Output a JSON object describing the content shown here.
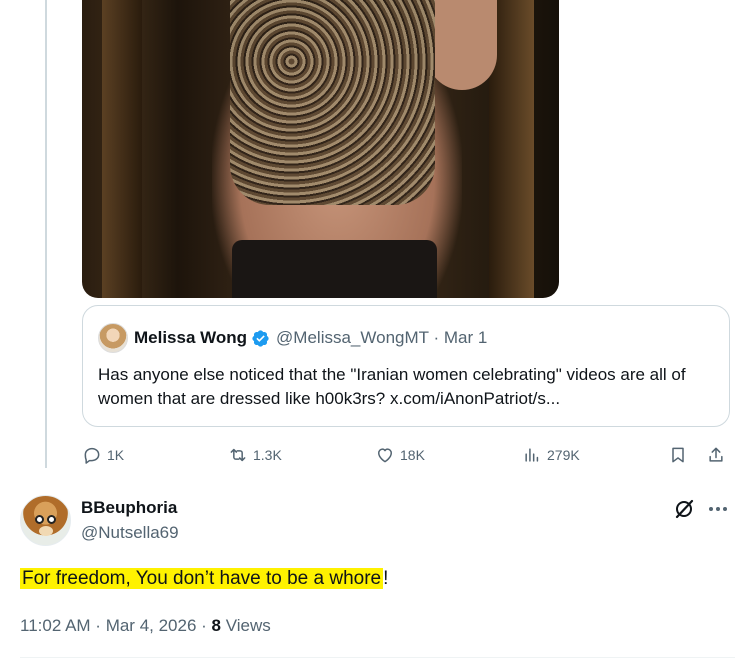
{
  "quoted_tweet": {
    "name": "Melissa Wong",
    "handle": "@Melissa_WongMT",
    "separator": "·",
    "date": "Mar 1",
    "text": "Has anyone else noticed that the \"Iranian women celebrating\" videos are all of women that are dressed like h00k3rs? x.com/iAnonPatriot/s..."
  },
  "actions": {
    "replies": "1K",
    "reposts": "1.3K",
    "likes": "18K",
    "views": "279K"
  },
  "reply": {
    "name": "BBeuphoria",
    "handle": "@Nutsella69",
    "text_highlighted": "For freedom, You don’t have to be a whore",
    "text_suffix": "!",
    "time": "11:02 AM",
    "date": "Mar 4, 2026",
    "views_count": "8",
    "views_label": "Views"
  },
  "colors": {
    "text": "#0f1419",
    "muted": "#536471",
    "verified": "#1d9bf0",
    "highlight": "#fff200",
    "border": "#cfd9de"
  },
  "icons": [
    "reply-icon",
    "repost-icon",
    "like-icon",
    "views-icon",
    "bookmark-icon",
    "share-icon",
    "grok-icon",
    "more-icon",
    "verified-badge-icon"
  ]
}
